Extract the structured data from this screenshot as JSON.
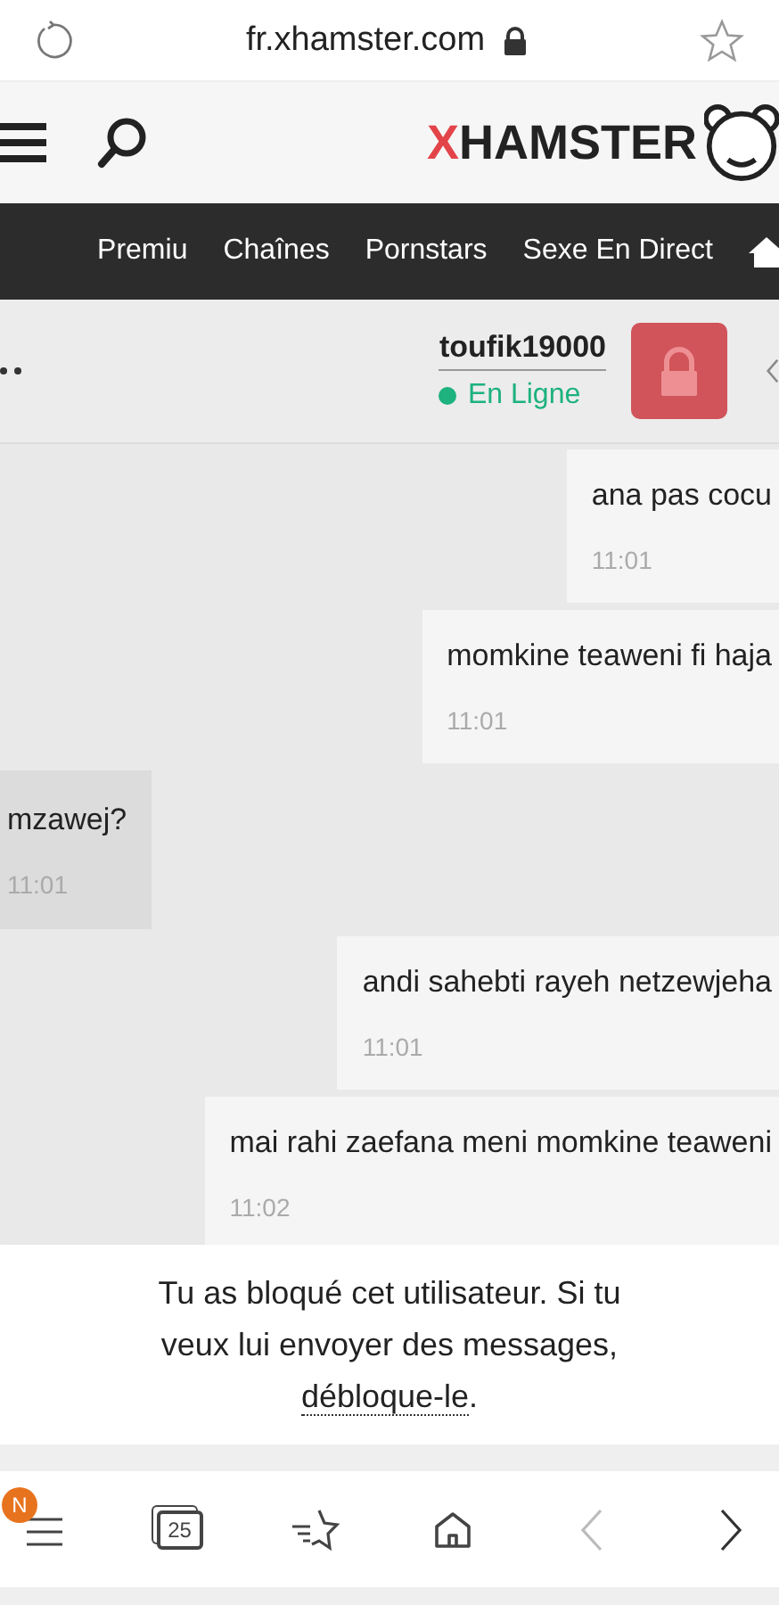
{
  "browser": {
    "url": "fr.xhamster.com"
  },
  "site_header": {
    "logo": {
      "accent": "X",
      "rest": "HAMSTER"
    }
  },
  "nav": {
    "items": [
      {
        "label": "Premiu"
      },
      {
        "label": "Chaînes"
      },
      {
        "label": "Pornstars"
      },
      {
        "label": "Sexe En Direct"
      }
    ]
  },
  "chat_header": {
    "username": "toufik19000",
    "status": "En Ligne",
    "online": true
  },
  "messages": [
    {
      "text": "ana pas cocu",
      "time": "11:01",
      "sent": true
    },
    {
      "text": "momkine teaweni fi haja",
      "time": "11:01",
      "sent": true
    },
    {
      "text": "mzawej?",
      "time": "11:01",
      "sent": false
    },
    {
      "text": "andi sahebti rayeh netzewjeha",
      "time": "11:01",
      "sent": true
    },
    {
      "text": "mai rahi zaefana meni momkine teaweni",
      "time": "11:02",
      "sent": true
    }
  ],
  "notice": {
    "before": "Tu as bloqué cet utilisateur. Si tu veux lui envoyer des messages, ",
    "link": "débloque-le",
    "after": "."
  },
  "toolbar": {
    "menu_badge": "N",
    "tab_count": "25",
    "nav_buttons": [
      {
        "kind": "back",
        "disabled": true
      },
      {
        "kind": "forward",
        "disabled": false
      }
    ]
  }
}
